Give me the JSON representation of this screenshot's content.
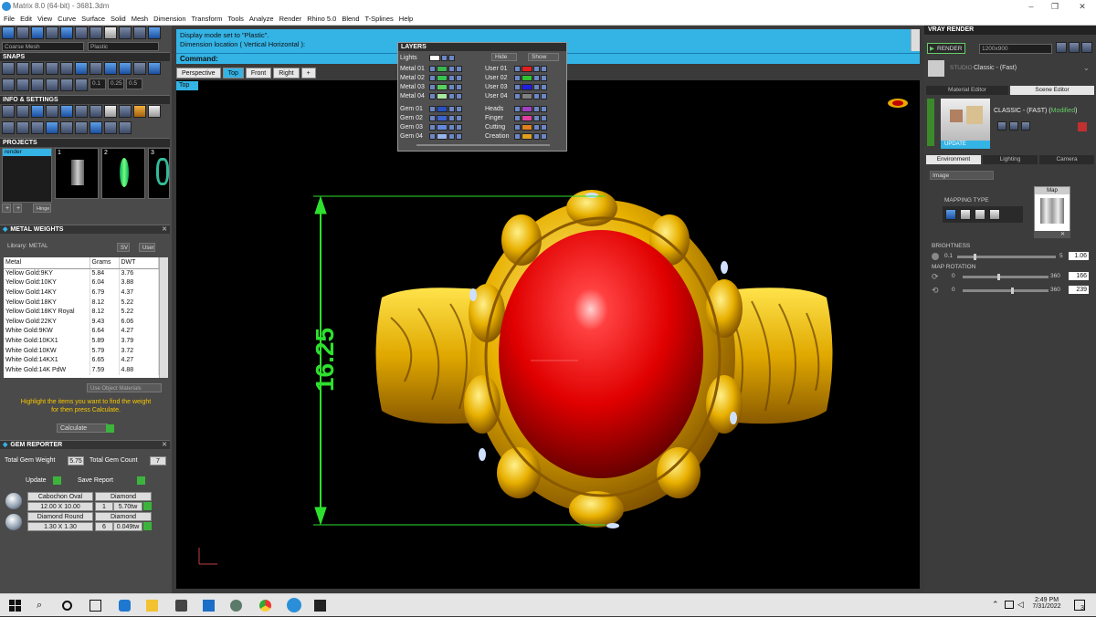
{
  "window": {
    "title": "Matrix 8.0 (64-bit) - 3681.3dm"
  },
  "menu": [
    "File",
    "Edit",
    "View",
    "Curve",
    "Surface",
    "Solid",
    "Mesh",
    "Dimension",
    "Transform",
    "Tools",
    "Analyze",
    "Render",
    "Rhino 5.0",
    "Blend",
    "T-Splines",
    "Help"
  ],
  "left": {
    "mesh_combo": "Coarse Mesh",
    "plastic_combo": "Plastic",
    "snaps_title": "SNAPS",
    "snap_values": [
      "0.1",
      "0.25",
      "0.5"
    ],
    "info_title": "INFO & SETTINGS",
    "projects_title": "PROJECTS",
    "projects_item": "render",
    "projects_thumbs": [
      "1",
      "2",
      "3"
    ],
    "hinge_label": "Hinge",
    "metal_weights_title": "METAL WEIGHTS",
    "library_label": "Library: METAL",
    "lib_btns": [
      "SV",
      "User"
    ],
    "mw_headers": [
      "Metal",
      "Grams",
      "DWT"
    ],
    "mw_rows": [
      [
        "Yellow Gold:9KY",
        "5.84",
        "3.76"
      ],
      [
        "Yellow Gold:10KY",
        "6.04",
        "3.88"
      ],
      [
        "Yellow Gold:14KY",
        "6.79",
        "4.37"
      ],
      [
        "Yellow Gold:18KY",
        "8.12",
        "5.22"
      ],
      [
        "Yellow Gold:18KY Royal",
        "8.12",
        "5.22"
      ],
      [
        "Yellow Gold:22KY",
        "9.43",
        "6.06"
      ],
      [
        "White Gold:9KW",
        "6.64",
        "4.27"
      ],
      [
        "White Gold:10KX1",
        "5.89",
        "3.79"
      ],
      [
        "White Gold:10KW",
        "5.79",
        "3.72"
      ],
      [
        "White Gold:14KX1",
        "6.65",
        "4.27"
      ],
      [
        "White Gold:14K PdW",
        "7.59",
        "4.88"
      ]
    ],
    "use_object_materials": "Use Object Materials",
    "highlight_text_1": "Highlight the items you want to find the weight",
    "highlight_text_2": "for then press Calculate.",
    "calculate_label": "Calculate",
    "gem_reporter_title": "GEM REPORTER",
    "total_gem_weight_label": "Total Gem Weight",
    "total_gem_weight_value": "5.75",
    "total_gem_count_label": "Total Gem Count",
    "total_gem_count_value": "7",
    "update_label": "Update",
    "save_report_label": "Save Report",
    "gems": [
      {
        "shape": "Cabochon Oval",
        "material": "Diamond",
        "size": "12.00 X 10.00",
        "count": "1",
        "weight": "5.70tw"
      },
      {
        "shape": "Diamond Round",
        "material": "Diamond",
        "size": "1.30 X 1.30",
        "count": "6",
        "weight": "0.049tw"
      }
    ]
  },
  "command": {
    "line1": "Display mode set to \"Plastic\".",
    "line2": "Dimension location ( Vertical  Horizontal ):",
    "prompt": "Command:"
  },
  "viewport_tabs": [
    "Perspective",
    "Top",
    "Front",
    "Right"
  ],
  "active_tab": "Top",
  "viewport_label": "Top",
  "dimension_text": "16.25",
  "layers": {
    "title": "LAYERS",
    "lights_label": "Lights",
    "hide_label": "Hide",
    "show_label": "Show",
    "left_rows": [
      {
        "name": "Metal 01",
        "color": "#3cb450"
      },
      {
        "name": "Metal 02",
        "color": "#38c050"
      },
      {
        "name": "Metal 03",
        "color": "#58d060"
      },
      {
        "name": "Metal 04",
        "color": "#a8e8a0"
      },
      {
        "name": "Gem 01",
        "color": "#2850c0"
      },
      {
        "name": "Gem 02",
        "color": "#3c64d0"
      },
      {
        "name": "Gem 03",
        "color": "#6488e0"
      },
      {
        "name": "Gem 04",
        "color": "#98b4ec"
      }
    ],
    "right_rows": [
      {
        "name": "User 01",
        "color": "#e02020"
      },
      {
        "name": "User 02",
        "color": "#30c030"
      },
      {
        "name": "User 03",
        "color": "#2020e0"
      },
      {
        "name": "User 04",
        "color": "#808080"
      },
      {
        "name": "Heads",
        "color": "#a040c0"
      },
      {
        "name": "Finger",
        "color": "#e040a0"
      },
      {
        "name": "Cutting",
        "color": "#e08020"
      },
      {
        "name": "Creation",
        "color": "#e0a020"
      }
    ]
  },
  "right": {
    "vray_title": "VRAY RENDER",
    "render_label": "RENDER",
    "resolution": "1200x900",
    "studio_label": "STUDIO",
    "preset": "Classic - (Fast)",
    "tabs": [
      "Material Editor",
      "Scene Editor"
    ],
    "scene_name": "CLASSIC - (FAST)",
    "modified": "Modified",
    "update_btn": "UPDATE",
    "env_tabs": [
      "Environment",
      "Lighting",
      "Camera"
    ],
    "image_combo": "Image",
    "mapping_type": "MAPPING TYPE",
    "map_label": "Map",
    "brightness_label": "BRIGHTNESS",
    "brightness_min": "0.1",
    "brightness_max": "5",
    "brightness_value": "1.06",
    "map_rotation_label": "MAP ROTATION",
    "rot1_min": "0",
    "rot1_max": "360",
    "rot1_value": "166",
    "rot2_min": "0",
    "rot2_max": "360",
    "rot2_value": "239"
  },
  "taskbar": {
    "time": "2:49 PM",
    "date": "7/31/2022",
    "notif_count": "3"
  },
  "colors": {
    "accent": "#34b3e5",
    "viewport_bg": "#000000",
    "gold": "#f2c200",
    "ruby": "#e01010",
    "dim_green": "#2ee02e"
  }
}
